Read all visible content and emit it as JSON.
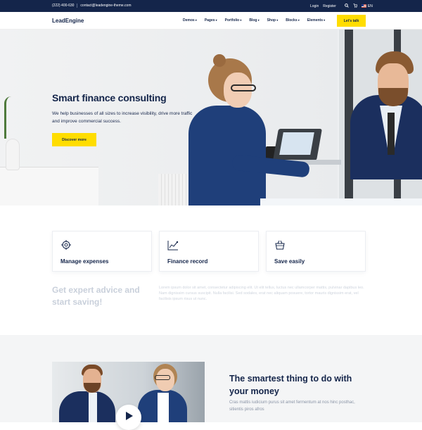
{
  "topbar": {
    "phone": "(222) 400-630",
    "email": "contact@leadengine-theme.com",
    "login": "Login",
    "register": "Register",
    "language": "EN"
  },
  "nav": {
    "logo": "LeadEngine",
    "items": [
      "Demos",
      "Pages",
      "Portfolio",
      "Blog",
      "Shop",
      "Blocks",
      "Elements"
    ],
    "cta": "Let's talk",
    "icons": [
      "search-icon",
      "cart-icon"
    ]
  },
  "hero": {
    "title": "Smart finance consulting",
    "description": "We help businesses of all sizes to increase visibility, drive more traffic and improve commercial success.",
    "button": "Discover more"
  },
  "features": [
    {
      "icon": "target-icon",
      "label": "Manage expenses"
    },
    {
      "icon": "chart-icon",
      "label": "Finance record"
    },
    {
      "icon": "basket-icon",
      "label": "Save easily"
    }
  ],
  "advice": {
    "title": "Get expert advice and start saving!",
    "text": "Lorem ipsum dolor sit amet, consectetur adipiscing elit. Ut elit tellus, luctus nec ullamcorper mattis, pulvinar dapibus leo. Nam dignissim cursus suscipit. Nulla facilisi. Sed sodales, erat nec aliquam posuere, tortor mauris dignissim erat, vel facilisis ipsum risus ut nunc."
  },
  "section2": {
    "title": "The smartest thing to do with your money",
    "description": "Cras mattis iudicium purus sit amet fermentum at nos hinc posthac, sitientis piros afros"
  },
  "colors": {
    "navy": "#14254a",
    "accent": "#ffdd00",
    "muted": "#c9d0db"
  }
}
